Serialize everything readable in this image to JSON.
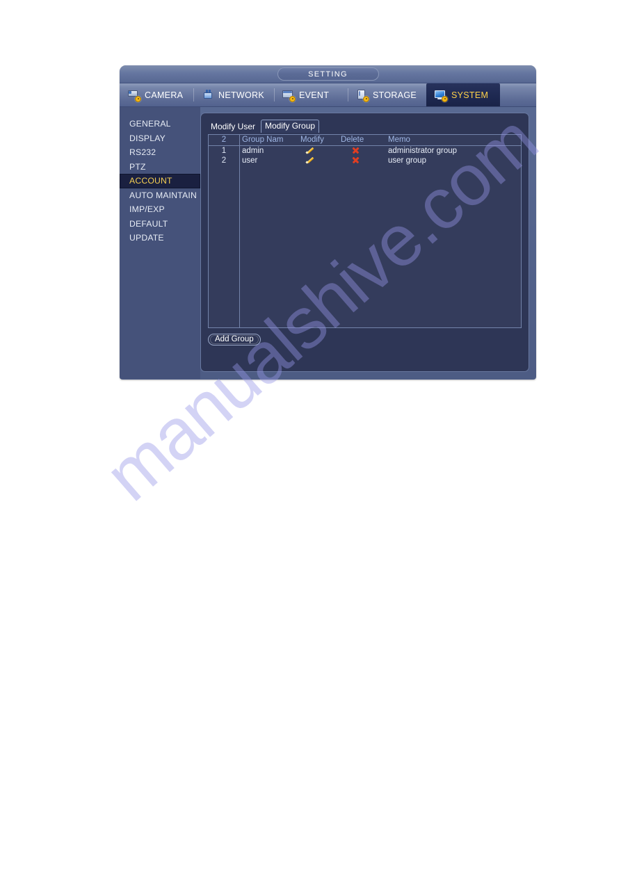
{
  "window": {
    "title": "SETTING"
  },
  "nav": {
    "tabs": [
      {
        "label": "CAMERA",
        "icon": "camera-icon",
        "active": false
      },
      {
        "label": "NETWORK",
        "icon": "network-icon",
        "active": false
      },
      {
        "label": "EVENT",
        "icon": "event-icon",
        "active": false
      },
      {
        "label": "STORAGE",
        "icon": "storage-icon",
        "active": false
      },
      {
        "label": "SYSTEM",
        "icon": "system-icon",
        "active": true
      }
    ]
  },
  "sidebar": {
    "items": [
      {
        "label": "GENERAL",
        "active": false
      },
      {
        "label": "DISPLAY",
        "active": false
      },
      {
        "label": "RS232",
        "active": false
      },
      {
        "label": "PTZ",
        "active": false
      },
      {
        "label": "ACCOUNT",
        "active": true
      },
      {
        "label": "AUTO MAINTAIN",
        "active": false
      },
      {
        "label": "IMP/EXP",
        "active": false
      },
      {
        "label": "DEFAULT",
        "active": false
      },
      {
        "label": "UPDATE",
        "active": false
      }
    ]
  },
  "main": {
    "subtabs": [
      {
        "label": "Modify User",
        "active": false
      },
      {
        "label": "Modify Group",
        "active": true
      }
    ],
    "table": {
      "headers": {
        "index": "2",
        "name": "Group Nam",
        "modify": "Modify",
        "delete": "Delete",
        "memo": "Memo"
      },
      "rows": [
        {
          "index": "1",
          "name": "admin",
          "modify_icon": "pencil-icon",
          "delete_icon": "x-icon",
          "memo": "administrator group"
        },
        {
          "index": "2",
          "name": "user",
          "modify_icon": "pencil-icon",
          "delete_icon": "x-icon",
          "memo": "user group"
        }
      ]
    },
    "add_group_label": "Add Group"
  },
  "watermark": {
    "text": "manualshive.com"
  },
  "colors": {
    "accent_gold": "#f5cf52",
    "panel_bg": "#2e3656",
    "table_bg": "#343c5c",
    "sidebar_bg": "#45527a",
    "active_nav_bg": "#1d2850",
    "delete_red": "#e03e22",
    "modify_yellow": "#f0b52a",
    "header_text": "#9fb6e4"
  }
}
